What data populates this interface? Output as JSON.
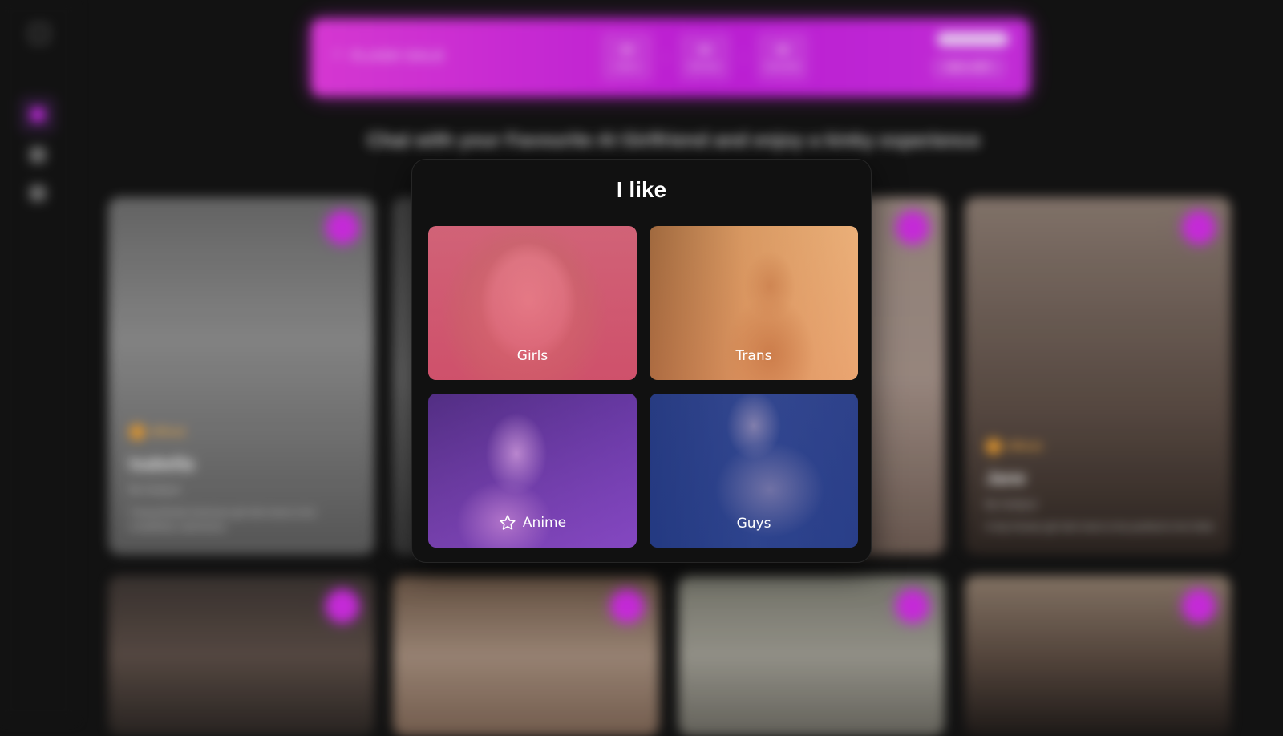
{
  "background": {
    "flash_sale": {
      "label": "FLASH SALE",
      "countdown": [
        {
          "value": "00",
          "unit": "Hours"
        },
        {
          "value": "00",
          "unit": "Minutes"
        },
        {
          "value": "00",
          "unit": "Seconds"
        }
      ],
      "discount": "50% OFF"
    },
    "headline": "Chat with your Favourite AI Girlfriend and enjoy a kinky experience",
    "cards": [
      {
        "name": "Isabella",
        "badge": "Official",
        "creator": "By Candy.ai",
        "description": "Young blonde American girl who loves to be completely submissive"
      },
      {
        "name": "Jane",
        "badge": "Official",
        "creator": "By Candy.ai",
        "description": "A shy Korean girl who loves to be pushed to her limits"
      }
    ]
  },
  "modal": {
    "title": "I like",
    "options": [
      {
        "label": "Girls",
        "icon": ""
      },
      {
        "label": "Trans",
        "icon": ""
      },
      {
        "label": "Anime",
        "icon": "star-icon"
      },
      {
        "label": "Guys",
        "icon": ""
      }
    ]
  },
  "colors": {
    "accent": "#d42de8",
    "modal_bg": "#111111",
    "page_bg": "#121212"
  }
}
